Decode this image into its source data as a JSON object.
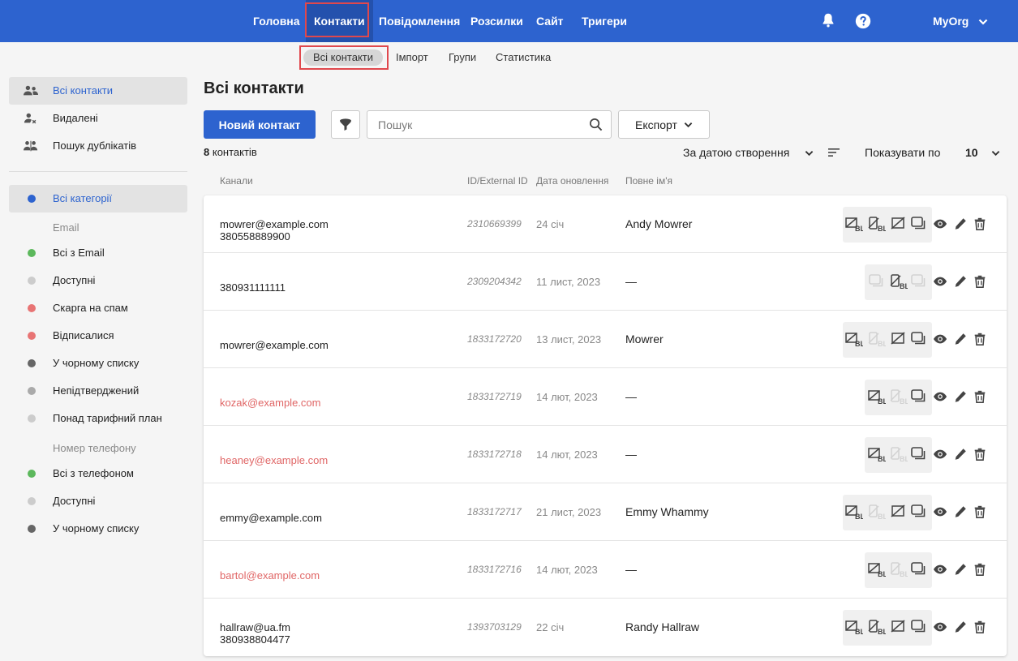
{
  "topnav": {
    "items": [
      {
        "label": "Головна"
      },
      {
        "label": "Контакти"
      },
      {
        "label": "Повідомлення"
      },
      {
        "label": "Розсилки"
      },
      {
        "label": "Сайт"
      },
      {
        "label": "Тригери"
      }
    ],
    "org": "MyOrg"
  },
  "subnav": {
    "items": [
      {
        "label": "Всі контакти"
      },
      {
        "label": "Імпорт"
      },
      {
        "label": "Групи"
      },
      {
        "label": "Статистика"
      }
    ]
  },
  "sidebar": {
    "items": [
      {
        "label": "Всі контакти",
        "icon": "users-icon"
      },
      {
        "label": "Видалені",
        "icon": "user-remove-icon"
      },
      {
        "label": "Пошук дублікатів",
        "icon": "duplicates-icon"
      }
    ],
    "categories": [
      {
        "label": "Всі категорії",
        "color": "#2d63cf"
      }
    ],
    "email_group": "Email",
    "email_items": [
      {
        "label": "Всі з Email",
        "color": "#5cb85c"
      },
      {
        "label": "Доступні",
        "color": "#cccccc"
      },
      {
        "label": "Скарга на спам",
        "color": "#e87474"
      },
      {
        "label": "Відписалися",
        "color": "#e87474"
      },
      {
        "label": "У чорному списку",
        "color": "#666666"
      },
      {
        "label": "Непідтверджений",
        "color": "#aaaaaa"
      },
      {
        "label": "Понад тарифний план",
        "color": "#cccccc"
      }
    ],
    "phone_group": "Номер телефону",
    "phone_items": [
      {
        "label": "Всі з телефоном",
        "color": "#5cb85c"
      },
      {
        "label": "Доступні",
        "color": "#cccccc"
      },
      {
        "label": "У чорному списку",
        "color": "#666666"
      }
    ]
  },
  "main": {
    "title": "Всі контакти",
    "new_contact": "Новий контакт",
    "search_placeholder": "Пошук",
    "export": "Експорт",
    "count_number": "8",
    "count_label": "контактів",
    "sort_label": "За датою створення",
    "per_page_label": "Показувати по",
    "per_page_value": "10",
    "columns": [
      "Канали",
      "ID/External ID",
      "Дата оновлення",
      "Повне ім'я"
    ]
  },
  "rows": [
    {
      "email": "mowrer@example.com",
      "phone": "380558889900",
      "id": "2310669399",
      "date": "24 січ",
      "name": "Andy Mowrer",
      "red": false
    },
    {
      "email": "",
      "phone": "380931111111",
      "id": "2309204342",
      "date": "11 лист, 2023",
      "name": "—",
      "red": false
    },
    {
      "email": "mowrer@example.com",
      "phone": "",
      "id": "1833172720",
      "date": "13 лист, 2023",
      "name": "Mowrer",
      "red": false
    },
    {
      "email": "kozak@example.com",
      "phone": "",
      "id": "1833172719",
      "date": "14 лют, 2023",
      "name": "—",
      "red": true
    },
    {
      "email": "heaney@example.com",
      "phone": "",
      "id": "1833172718",
      "date": "14 лют, 2023",
      "name": "—",
      "red": true
    },
    {
      "email": "emmy@example.com",
      "phone": "",
      "id": "1833172717",
      "date": "21 лист, 2023",
      "name": "Emmy Whammy",
      "red": false
    },
    {
      "email": "bartol@example.com",
      "phone": "",
      "id": "1833172716",
      "date": "14 лют, 2023",
      "name": "—",
      "red": true
    },
    {
      "email": "hallraw@ua.fm",
      "phone": "380938804477",
      "id": "1393703129",
      "date": "22 січ",
      "name": "Randy Hallraw",
      "red": false
    }
  ],
  "icons": {
    "bell": "bell-icon",
    "help": "help-icon",
    "filter": "filter-icon",
    "search": "search-icon",
    "view": "eye-icon",
    "edit": "pencil-icon",
    "delete": "trash-icon"
  },
  "colors": {
    "brand": "#2d63cf",
    "highlight": "#e0484d",
    "error_email": "#e06666"
  }
}
